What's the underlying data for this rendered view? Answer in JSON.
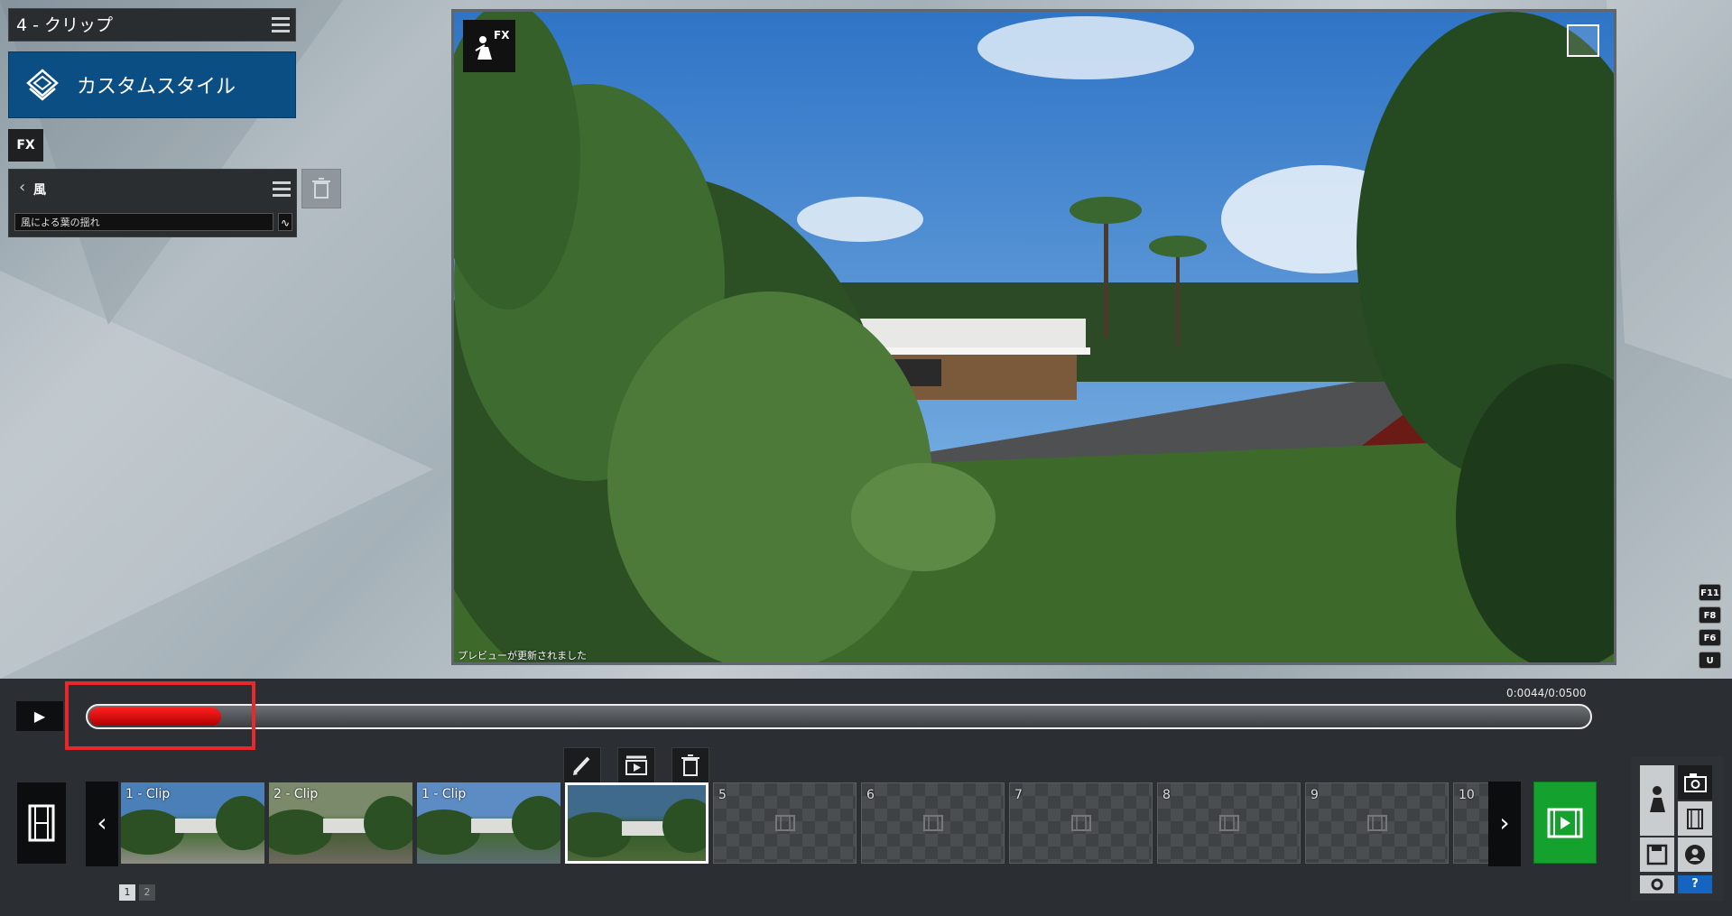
{
  "clip_panel": {
    "title": "4 - クリップ",
    "style_button_label": "カスタムスタイル",
    "fx_label": "FX"
  },
  "effect_panel": {
    "title": "風",
    "effect_value": "風による葉の揺れ",
    "curve_icon": "∿"
  },
  "preview": {
    "fx_badge": "FX",
    "status": "プレビューが更新されました"
  },
  "shortcut_keys": [
    "F11",
    "F8",
    "F6",
    "U"
  ],
  "timeline": {
    "play_icon": "▶",
    "timecode": "0:0044/0:0500",
    "progress": 0.088
  },
  "clips": [
    {
      "label": "1 - Clip",
      "kind": "image"
    },
    {
      "label": "2 - Clip",
      "kind": "image"
    },
    {
      "label": "1 - Clip",
      "kind": "image"
    },
    {
      "label": "",
      "kind": "image",
      "selected": true
    },
    {
      "label": "5",
      "kind": "empty"
    },
    {
      "label": "6",
      "kind": "empty"
    },
    {
      "label": "7",
      "kind": "empty"
    },
    {
      "label": "8",
      "kind": "empty"
    },
    {
      "label": "9",
      "kind": "empty"
    },
    {
      "label": "10",
      "kind": "empty"
    }
  ],
  "nav": {
    "prev": "‹",
    "next": "›"
  },
  "pages": [
    "1",
    "2"
  ],
  "help_label": "?",
  "colors": {
    "accent_blue": "#0b4e84",
    "progress_red": "#e8282a",
    "render_green": "#14a12e"
  }
}
